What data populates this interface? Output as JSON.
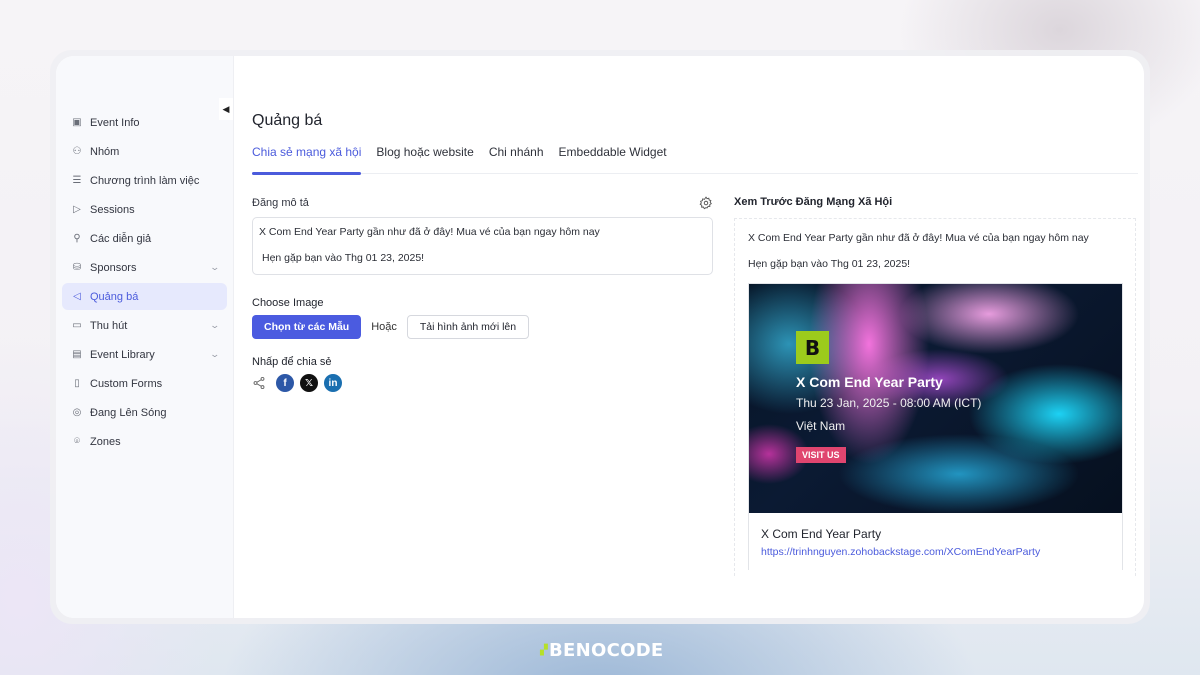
{
  "sidebar": {
    "items": [
      {
        "label": "Event Info",
        "icon": "info-calendar-icon",
        "has_chevron": false,
        "active": false
      },
      {
        "label": "Nhóm",
        "icon": "team-icon",
        "has_chevron": false,
        "active": false
      },
      {
        "label": "Chương trình làm việc",
        "icon": "agenda-icon",
        "has_chevron": false,
        "active": false
      },
      {
        "label": "Sessions",
        "icon": "session-play-icon",
        "has_chevron": false,
        "active": false
      },
      {
        "label": "Các diễn giả",
        "icon": "speaker-icon",
        "has_chevron": false,
        "active": false
      },
      {
        "label": "Sponsors",
        "icon": "sponsor-icon",
        "has_chevron": true,
        "active": false
      },
      {
        "label": "Quảng bá",
        "icon": "megaphone-icon",
        "has_chevron": false,
        "active": true
      },
      {
        "label": "Thu hút",
        "icon": "chat-icon",
        "has_chevron": true,
        "active": false
      },
      {
        "label": "Event Library",
        "icon": "folder-icon",
        "has_chevron": true,
        "active": false
      },
      {
        "label": "Custom Forms",
        "icon": "form-icon",
        "has_chevron": false,
        "active": false
      },
      {
        "label": "Đang Lên Sóng",
        "icon": "live-icon",
        "has_chevron": false,
        "active": false
      },
      {
        "label": "Zones",
        "icon": "location-pin-icon",
        "has_chevron": false,
        "active": false
      }
    ]
  },
  "page": {
    "title": "Quảng bá",
    "tabs": [
      {
        "label": "Chia sẻ mạng xã hội",
        "active": true
      },
      {
        "label": "Blog hoặc website",
        "active": false
      },
      {
        "label": "Chi nhánh",
        "active": false
      },
      {
        "label": "Embeddable Widget",
        "active": false
      }
    ]
  },
  "post": {
    "description_label": "Đăng mô tả",
    "description_line1": "X Com End Year Party gần như đã ở đây! Mua vé của bạn ngay hôm nay",
    "description_line2": "Hẹn gặp bạn vào Thg 01 23, 2025!",
    "choose_image_label": "Choose Image",
    "choose_template_button": "Chọn từ các Mẫu",
    "or_label": "Hoặc",
    "upload_button": "Tải hình ảnh mới lên",
    "share_label": "Nhấp để chia sẻ",
    "share_targets": [
      "share",
      "facebook",
      "x",
      "linkedin"
    ]
  },
  "preview": {
    "title": "Xem Trước Đăng Mạng Xã Hội",
    "text_line1": "X Com End Year Party gần như đã ở đây! Mua vé của bạn ngay hôm nay",
    "text_line2": "Hẹn gặp bạn vào Thg 01 23, 2025!",
    "banner": {
      "event_title": "X Com End Year Party",
      "datetime": "Thu 23 Jan, 2025 - 08:00 AM (ICT)",
      "location": "Việt Nam",
      "cta": "VISIT US",
      "logo_letter": "B"
    },
    "card_title": "X Com End Year Party",
    "card_link": "https://trinhnguyen.zohobackstage.com/XComEndYearParty"
  },
  "watermark": {
    "text": "BENOCODE"
  },
  "colors": {
    "accent": "#4b5bdc",
    "active_bg": "#e6e9fd",
    "cta": "#e0456f",
    "logo": "#9ccb1c"
  }
}
